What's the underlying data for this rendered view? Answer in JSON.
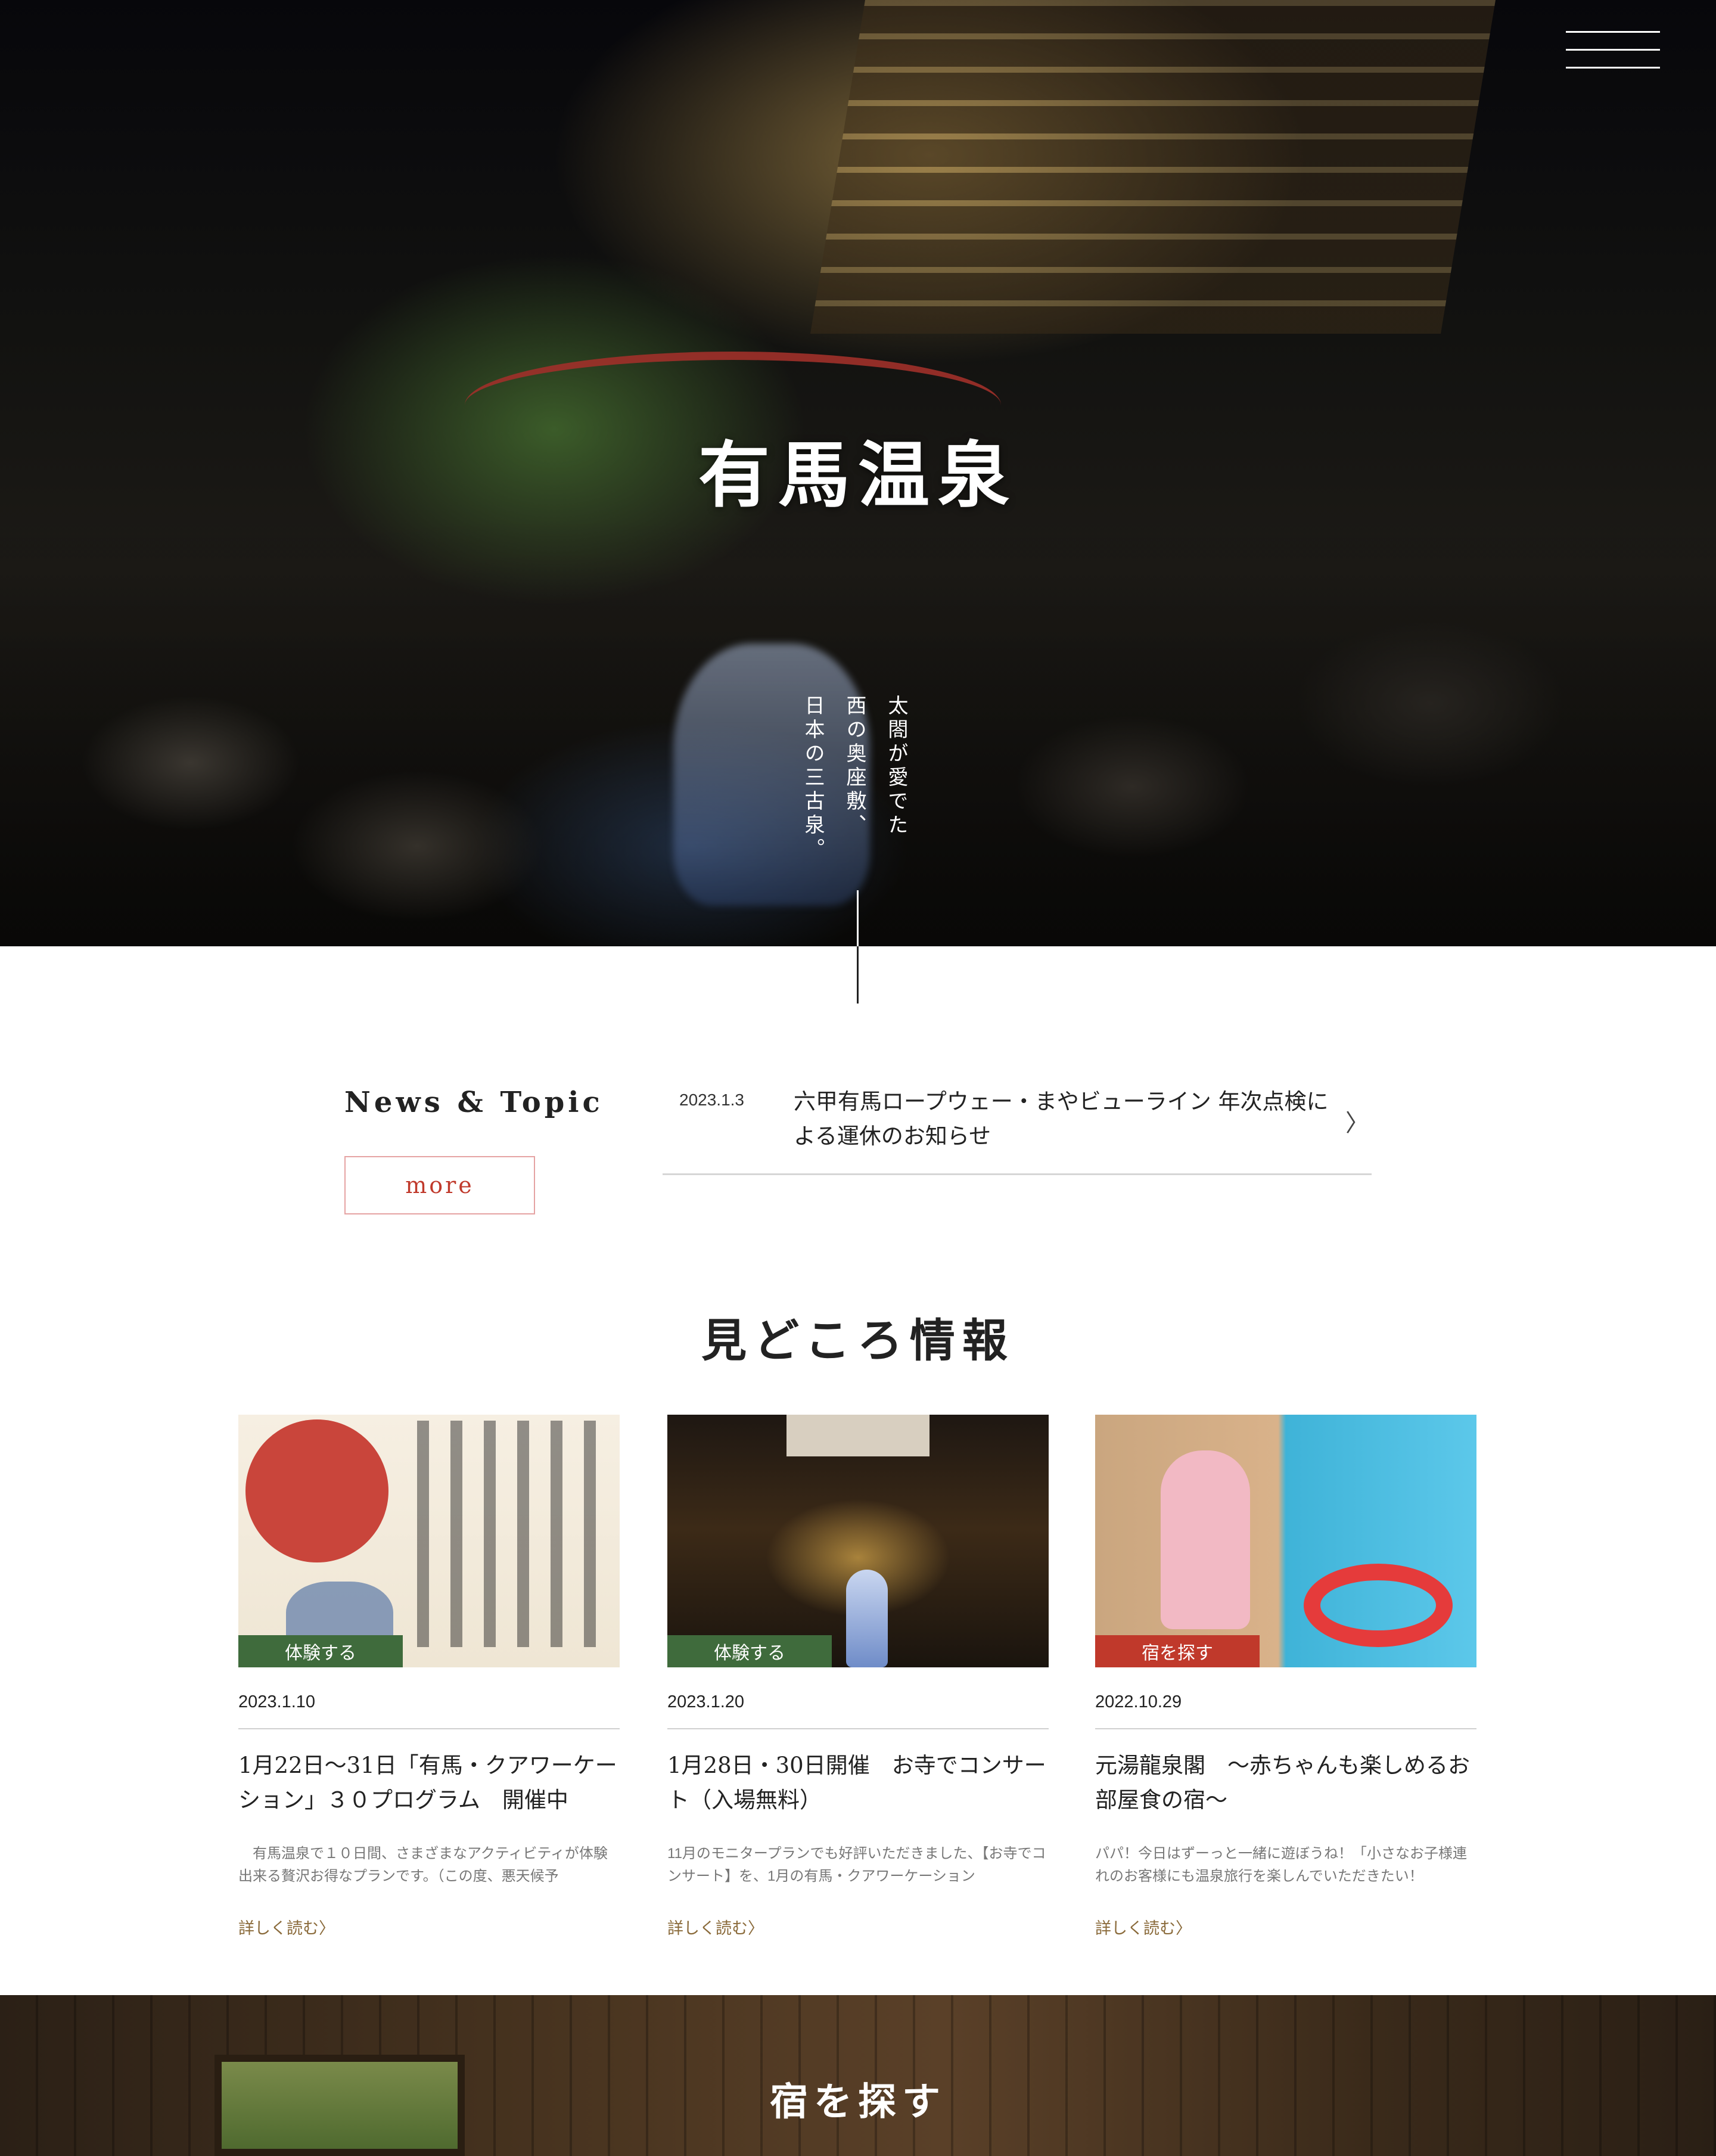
{
  "hero": {
    "title": "有馬温泉",
    "tagline": [
      "太閤が愛でた",
      "西の奥座敷、",
      "日本の三古泉。"
    ]
  },
  "news": {
    "heading": "News & Topic",
    "more_label": "more",
    "items": [
      {
        "date": "2023.1.3",
        "title": "六甲有馬ロープウェー・まやビューライン 年次点検による運休のお知らせ"
      }
    ]
  },
  "features": {
    "title": "見どころ情報",
    "read_more_label": "詳しく読む〉",
    "cards": [
      {
        "badge": "体験する",
        "badge_color": "#3f6b3c",
        "date": "2023.1.10",
        "title": "1月22日〜31日「有馬・クアワーケーション」３０プログラム　開催中",
        "desc": "　有馬温泉で１０日間、さまざまなアクティビティが体験出来る贅沢お得なプランです。（この度、悪天候予"
      },
      {
        "badge": "体験する",
        "badge_color": "#3f6b3c",
        "date": "2023.1.20",
        "title": "1月28日・30日開催　お寺でコンサート（入場無料）",
        "desc": "11月のモニタープランでも好評いただきました、【お寺でコンサート】を、1月の有馬・クアワーケーション"
      },
      {
        "badge": "宿を探す",
        "badge_color": "#c0392b",
        "date": "2022.10.29",
        "title": "元湯龍泉閣　〜赤ちゃんも楽しめるお部屋食の宿〜",
        "desc": "パパ！今日はずーっと一緒に遊ぼうね！「小さなお子様連れのお客様にも温泉旅行を楽しんでいただきたい！"
      }
    ]
  },
  "stay": {
    "title": "宿を探す"
  },
  "icons": {
    "menu": "hamburger-menu-icon",
    "chevron": "chevron-right-icon"
  }
}
